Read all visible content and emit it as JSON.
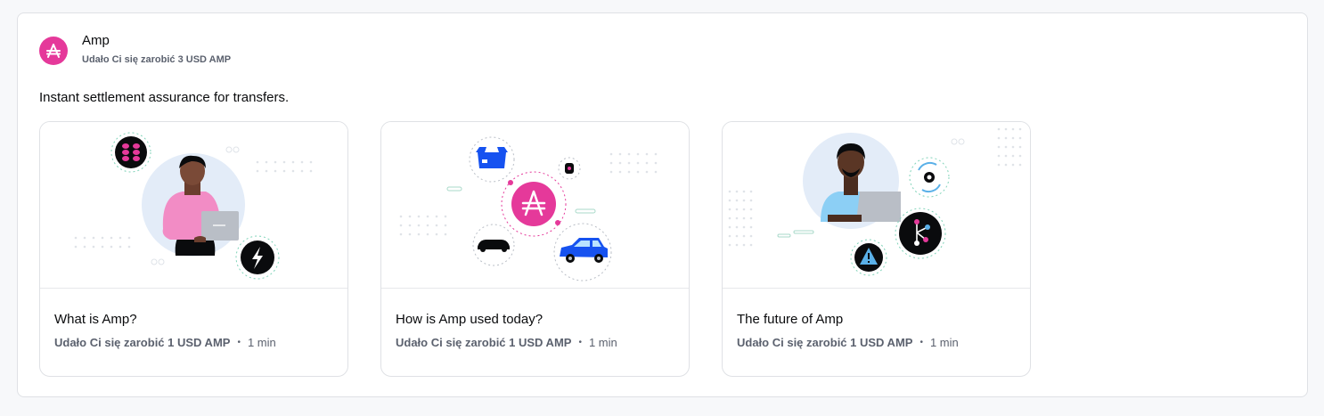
{
  "asset": {
    "name": "Amp",
    "reward": "Udało Ci się zarobić 3 USD AMP",
    "brand_color": "#e5399a",
    "icon": "amp-logo-icon"
  },
  "tagline": "Instant settlement assurance for transfers.",
  "lessons": [
    {
      "title": "What is Amp?",
      "reward": "Udało Ci się zarobić 1 USD AMP",
      "separator": "•",
      "duration": "1 min",
      "illustration": "person-with-laptop-illustration"
    },
    {
      "title": "How is Amp used today?",
      "reward": "Udało Ci się zarobić 1 USD AMP",
      "separator": "•",
      "duration": "1 min",
      "illustration": "amp-network-illustration"
    },
    {
      "title": "The future of Amp",
      "reward": "Udało Ci się zarobić 1 USD AMP",
      "separator": "•",
      "duration": "1 min",
      "illustration": "developer-at-laptop-illustration"
    }
  ]
}
